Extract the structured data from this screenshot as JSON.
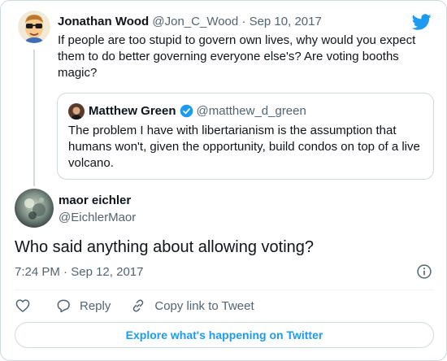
{
  "parent_tweet": {
    "author_name": "Jonathan Wood",
    "handle": "@Jon_C_Wood",
    "separator": "·",
    "date": "Sep 10, 2017",
    "text": "If people are too stupid to govern own lives, why would you expect them to do better governing everyone else's? Are voting booths magic?"
  },
  "quoted_tweet": {
    "author_name": "Matthew Green",
    "handle": "@matthew_d_green",
    "text": "The problem I have with libertarianism is the assumption that humans won't, given the opportunity, build condos on top of a live volcano."
  },
  "main_tweet": {
    "author_name": "maor eichler",
    "handle": "@EichlerMaor",
    "text": "Who said anything about allowing voting?",
    "time": "7:24 PM",
    "separator": "·",
    "date": "Sep 12, 2017"
  },
  "actions": {
    "reply_label": "Reply",
    "copy_link_label": "Copy link to Tweet"
  },
  "explore_label": "Explore what's happening on Twitter",
  "icons": {
    "brand": "twitter-bird-icon",
    "verified": "verified-badge-icon",
    "info": "info-icon",
    "like": "heart-icon",
    "reply": "reply-bubble-icon",
    "copy": "link-icon"
  },
  "colors": {
    "brand": "#1d9bf0",
    "text_primary": "#0f1419",
    "text_secondary": "#536471",
    "border": "#cfd9de"
  }
}
